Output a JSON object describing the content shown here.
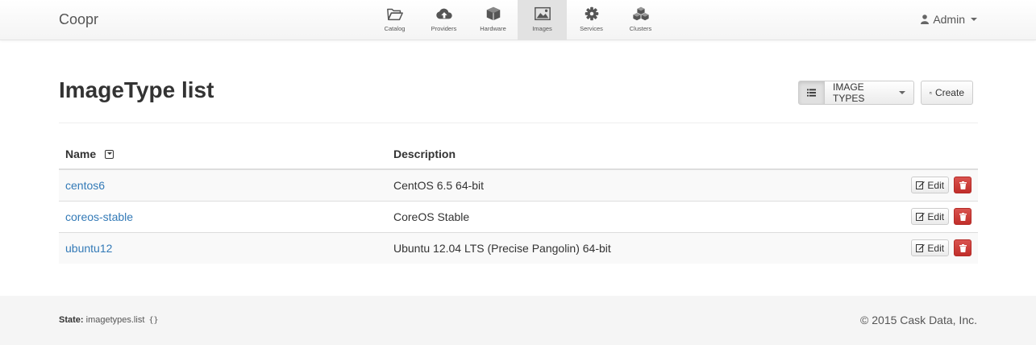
{
  "navbar": {
    "brand": "Coopr",
    "items": [
      {
        "label": "Catalog",
        "icon": "folder-open-icon"
      },
      {
        "label": "Providers",
        "icon": "cloud-upload-icon"
      },
      {
        "label": "Hardware",
        "icon": "cube-icon"
      },
      {
        "label": "Images",
        "icon": "picture-icon",
        "active": true
      },
      {
        "label": "Services",
        "icon": "gear-icon"
      },
      {
        "label": "Clusters",
        "icon": "cubes-icon"
      }
    ],
    "user": "Admin"
  },
  "page": {
    "title": "ImageType list",
    "types_button": "IMAGE TYPES",
    "create_button": "Create"
  },
  "table": {
    "headers": {
      "name": "Name",
      "description": "Description"
    },
    "rows": [
      {
        "name": "centos6",
        "description": "CentOS 6.5 64-bit",
        "edit": "Edit"
      },
      {
        "name": "coreos-stable",
        "description": "CoreOS Stable",
        "edit": "Edit"
      },
      {
        "name": "ubuntu12",
        "description": "Ubuntu 12.04 LTS (Precise Pangolin) 64-bit",
        "edit": "Edit"
      }
    ]
  },
  "footer": {
    "state_label": "State:",
    "state_value": "imagetypes.list",
    "state_params": "{}",
    "copyright": "© 2015 Cask Data, Inc."
  },
  "colors": {
    "link": "#337ab7",
    "danger": "#d9534f",
    "active_nav": "#e2e2e2"
  }
}
